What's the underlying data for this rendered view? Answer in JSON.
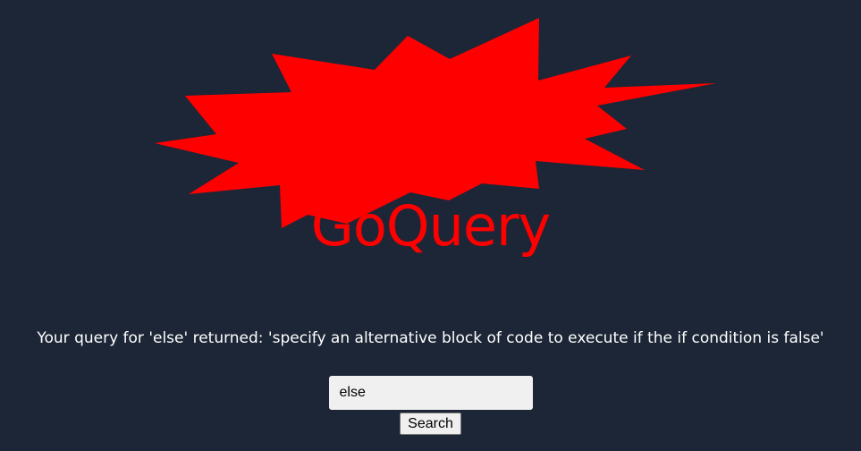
{
  "logo": {
    "text": "GoQuery",
    "color": "#ff0000",
    "icon": "starburst-icon"
  },
  "result": {
    "text": "Your query for 'else' returned: 'specify an alternative block of code to execute if the if condition is false'"
  },
  "search": {
    "value": "else",
    "button_label": "Search"
  },
  "colors": {
    "background": "#1c2636",
    "text": "#ffffff",
    "accent": "#ff0000"
  }
}
